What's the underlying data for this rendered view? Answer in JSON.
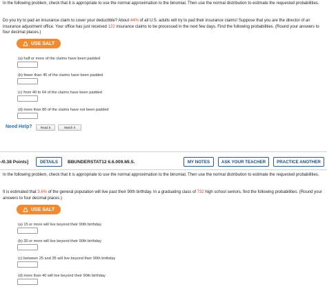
{
  "q1": {
    "instruction": "In the following problem, check that it is appropriate to use the normal approximation to the binomial. Then use the normal distribution to estimate the requested probabilities.",
    "body_pre": "Do you try to pad an insurance claim to cover your deductible? About ",
    "body_pct": "44%",
    "body_mid": " of all U.S. adults will try to pad their insurance claims! Suppose that you are the director of an insurance adjustment office. Your office has just received ",
    "body_n": "122",
    "body_post": " insurance claims to be processed in the next few days. Find the following probabilities. (Round your answers to four decimal places.)",
    "use_salt": "USE SALT",
    "parts": [
      {
        "label": "(a) half or more of the claims have been padded"
      },
      {
        "label": "(b) fewer than 45 of the claims have been padded"
      },
      {
        "label": "(c) from 40 to 64 of the claims have been padded"
      },
      {
        "label": "(d) more than 80 of the claims have not been padded"
      }
    ],
    "need_help": "Need Help?",
    "read_it": "Read It",
    "watch_it": "Watch It"
  },
  "q2": {
    "points": "-/0.38 Points]",
    "details": "DETAILS",
    "code": "BBUNDERSTAT12 6.6.009.MI.S.",
    "my_notes": "MY NOTES",
    "ask_teacher": "ASK YOUR TEACHER",
    "practice_another": "PRACTICE ANOTHER",
    "instruction": "In the following problem, check that it is appropriate to use the normal approximation to the binomial. Then use the normal distribution to estimate the requested probabilities.",
    "body_pre": "It is estimated that ",
    "body_pct": "3.6%",
    "body_mid": " of the general population will live past their 90th birthday. In a graduating class of ",
    "body_n": "732",
    "body_post": " high school seniors, find the following probabilities. (Round your answers to four decimal places.)",
    "use_salt": "USE SALT",
    "parts": [
      {
        "label": "(a) 15 or more will live beyond their 90th birthday"
      },
      {
        "label": "(b) 30 or more will live beyond their 90th birthday"
      },
      {
        "label": "(c) between 25 and 35 will live beyond their 90th birthday"
      },
      {
        "label": "(d) more than 40 will live beyond their 90th birthday"
      }
    ]
  },
  "colors": {
    "accent_orange": "#f28a2e",
    "highlight_red": "#d9412b",
    "button_blue": "#1f4a7a",
    "help_blue": "#2a6db0"
  },
  "icons": {
    "salt": "salt-shaker-icon"
  }
}
